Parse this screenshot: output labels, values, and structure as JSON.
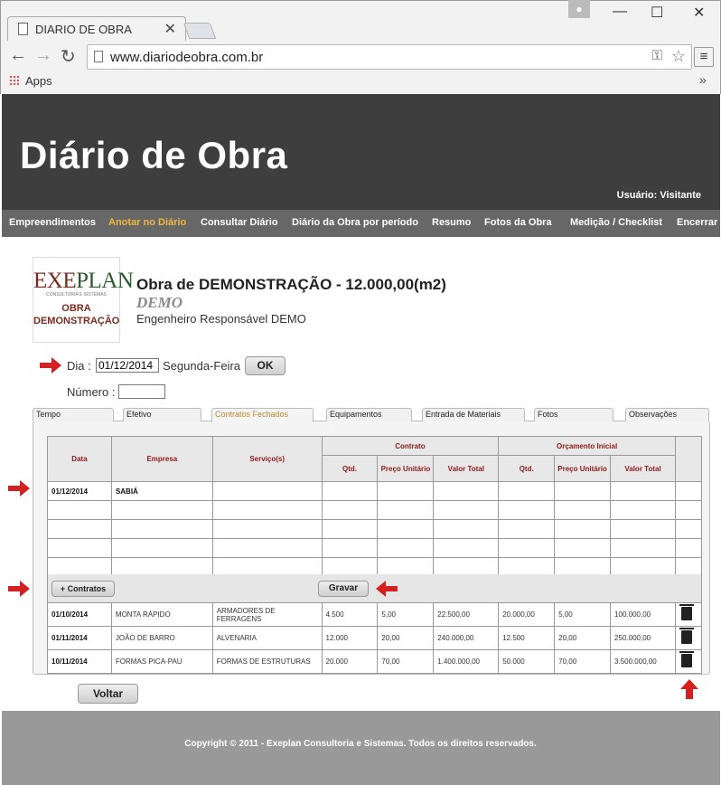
{
  "browser": {
    "tab_title": "DIARIO DE OBRA",
    "url": "www.diariodeobra.com.br",
    "bookmarks_apps": "Apps",
    "more": "»"
  },
  "site": {
    "title": "Diário de Obra",
    "user": "Usuário: Visitante",
    "nav": [
      "Empreendimentos",
      "Anotar no Diário",
      "Consultar Diário",
      "Diário da Obra por período",
      "Resumo",
      "Fotos da Obra",
      "Medição / Checklist",
      "Encerrar"
    ],
    "active_nav": "Anotar no Diário"
  },
  "logo": {
    "l1a": "EXE",
    "l1b": "PLAN",
    "l2": "CONSULTORIA E SISTEMAS",
    "l3": "OBRA",
    "l4": "DEMONSTRAÇÃO"
  },
  "obra": {
    "title": "Obra de DEMONSTRAÇÃO - 12.000,00(m2)",
    "subtitle": "DEMO",
    "engineer": "Engenheiro Responsável DEMO"
  },
  "form": {
    "dia_label": "Dia :",
    "dia_value": "01/12/2014",
    "weekday": "Segunda-Feira",
    "ok": "OK",
    "numero_label": "Número :",
    "numero_value": ""
  },
  "tabs": [
    "Tempo",
    "Efetivo",
    "Contratos Fechados",
    "Equipamentos",
    "Entrada de Materiais",
    "Fotos",
    "Observações"
  ],
  "grid": {
    "headers": {
      "data": "Data",
      "empresa": "Empresa",
      "servicos": "Serviço(s)",
      "contrato": "Contrato",
      "orcamento": "Orçamento Inicial",
      "qtd": "Qtd.",
      "preco": "Preço Unitário",
      "valor": "Valor Total"
    },
    "entry": {
      "data": "01/12/2014",
      "empresa": "SABIÁ"
    }
  },
  "buttons": {
    "add_contratos": "+ Contratos",
    "gravar": "Gravar",
    "voltar": "Voltar"
  },
  "contracts": [
    {
      "data": "01/10/2014",
      "empresa": "MONTA RÁPIDO",
      "servico": "ARMADORES DE FERRAGENS",
      "qtd": "4.500",
      "preco": "5,00",
      "valor": "22.500,00",
      "oqtd": "20.000,00",
      "opreco": "5,00",
      "ovalor": "100.000,00"
    },
    {
      "data": "01/11/2014",
      "empresa": "JOÃO DE BARRO",
      "servico": "ALVENARIA",
      "qtd": "12.000",
      "preco": "20,00",
      "valor": "240.000,00",
      "oqtd": "12.500",
      "opreco": "20,00",
      "ovalor": "250.000,00"
    },
    {
      "data": "10/11/2014",
      "empresa": "FORMAS PICA-PAU",
      "servico": "FORMAS DE ESTRUTURAS",
      "qtd": "20.000",
      "preco": "70,00",
      "valor": "1.400.000,00",
      "oqtd": "50.000",
      "opreco": "70,00",
      "ovalor": "3.500.000,00"
    }
  ],
  "footer": "Copyright © 2011 - Exeplan Consultoria e Sistemas. Todos os direitos reservados.",
  "colors": {
    "header": "#3e3e3e",
    "nav": "#676767",
    "active": "#f0b83c",
    "arrow": "#d42020"
  }
}
